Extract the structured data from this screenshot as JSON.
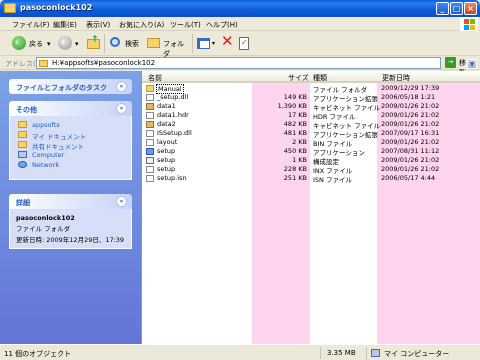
{
  "window": {
    "title": "pasoconlock102"
  },
  "menu": [
    "ファイル(F)",
    "編集(E)",
    "表示(V)",
    "お気に入り(A)",
    "ツール(T)",
    "ヘルプ(H)"
  ],
  "toolbar": {
    "back": "戻る",
    "search": "検索",
    "folders": "フォルダ"
  },
  "address": {
    "label": "アドレス(D)",
    "path": "H:¥appsofts¥pasoconlock102",
    "go": "移動"
  },
  "tasks": {
    "title": "ファイルとフォルダのタスク"
  },
  "places": {
    "title": "その他",
    "items": [
      "appsofts",
      "マイ ドキュメント",
      "共有ドキュメント",
      "Computer",
      "Network"
    ]
  },
  "details": {
    "title": "詳細",
    "name": "pasoconlock102",
    "type": "ファイル フォルダ",
    "modified": "更新日時: 2009年12月29日、17:39"
  },
  "columns": {
    "name": "名前",
    "size": "サイズ",
    "type": "種類",
    "date": "更新日時"
  },
  "files": [
    {
      "name": "Manual",
      "size": "",
      "type": "ファイル フォルダ",
      "date": "2009/12/29 17:39",
      "icon": "folder"
    },
    {
      "name": "_setup.dll",
      "size": "149 KB",
      "type": "アプリケーション拡張",
      "date": "2006/05/18 1:21",
      "icon": "file"
    },
    {
      "name": "data1",
      "size": "1,390 KB",
      "type": "キャビネット ファイル",
      "date": "2009/01/26 21:02",
      "icon": "cab"
    },
    {
      "name": "data1.hdr",
      "size": "17 KB",
      "type": "HDR ファイル",
      "date": "2009/01/26 21:02",
      "icon": "file"
    },
    {
      "name": "data2",
      "size": "482 KB",
      "type": "キャビネット ファイル",
      "date": "2009/01/26 21:02",
      "icon": "cab"
    },
    {
      "name": "ISSetup.dll",
      "size": "481 KB",
      "type": "アプリケーション拡張",
      "date": "2007/09/17 16:31",
      "icon": "file"
    },
    {
      "name": "layout",
      "size": "2 KB",
      "type": "BIN ファイル",
      "date": "2009/01/26 21:02",
      "icon": "file"
    },
    {
      "name": "setup",
      "size": "450 KB",
      "type": "アプリケーション",
      "date": "2007/08/31 11:12",
      "icon": "app"
    },
    {
      "name": "setup",
      "size": "1 KB",
      "type": "構成設定",
      "date": "2009/01/26 21:02",
      "icon": "ini"
    },
    {
      "name": "setup",
      "size": "228 KB",
      "type": "INX ファイル",
      "date": "2009/01/26 21:02",
      "icon": "file"
    },
    {
      "name": "setup.isn",
      "size": "251 KB",
      "type": "ISN ファイル",
      "date": "2006/05/17 4:44",
      "icon": "file"
    }
  ],
  "status": {
    "objects": "11 個のオブジェクト",
    "size": "3.35 MB",
    "location": "マイ コンピューター"
  }
}
